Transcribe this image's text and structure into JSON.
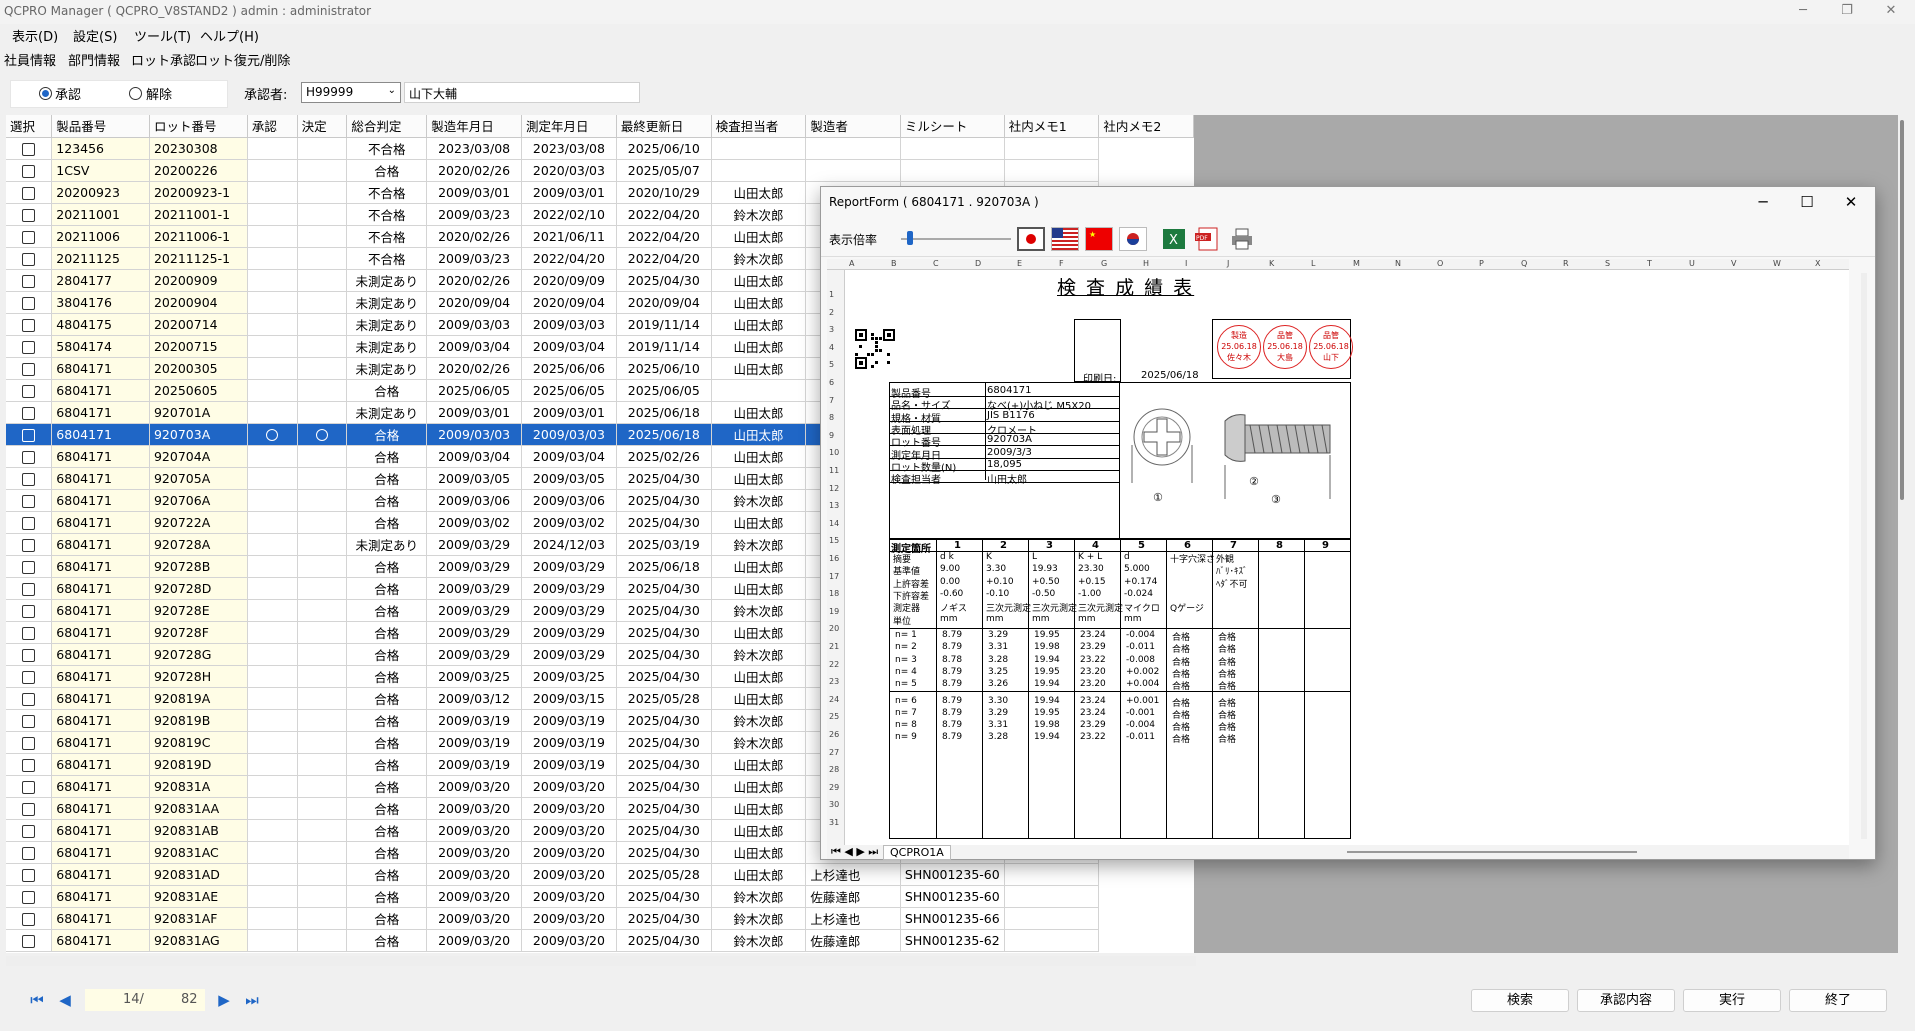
{
  "window": {
    "title": "QCPRO Manager ( QCPRO_V8STAND2 )    admin : administrator"
  },
  "menu": [
    "表示(D)",
    "設定(S)",
    "ツール(T)",
    "ヘルプ(H)"
  ],
  "subtabs": [
    "社員情報",
    "部門情報",
    "ロット承認",
    "ロット復元/削除"
  ],
  "mode": {
    "approve": "承認",
    "release": "解除",
    "selected": "承認"
  },
  "approver": {
    "label": "承認者:",
    "code": "H99999",
    "name": "山下大輔"
  },
  "columns": [
    "選択",
    "製品番号",
    "ロット番号",
    "承認",
    "決定",
    "総合判定",
    "製造年月日",
    "測定年月日",
    "最終更新日",
    "検査担当者",
    "製造者",
    "ミルシート",
    "社内メモ1",
    "社内メモ2"
  ],
  "rows": [
    [
      "123456",
      "20230308",
      "",
      "",
      "不合格",
      "2023/03/08",
      "2023/03/08",
      "2025/06/10",
      "",
      "",
      "",
      ""
    ],
    [
      "1CSV",
      "20200226",
      "",
      "",
      "合格",
      "2020/02/26",
      "2020/03/03",
      "2025/05/07",
      "",
      "",
      "",
      ""
    ],
    [
      "20200923",
      "20200923-1",
      "",
      "",
      "不合格",
      "2009/03/01",
      "2009/03/01",
      "2020/10/29",
      "山田太郎",
      "",
      "",
      ""
    ],
    [
      "20211001",
      "20211001-1",
      "",
      "",
      "不合格",
      "2009/03/23",
      "2022/02/10",
      "2022/04/20",
      "鈴木次郎",
      "",
      "",
      ""
    ],
    [
      "20211006",
      "20211006-1",
      "",
      "",
      "不合格",
      "2020/02/26",
      "2021/06/11",
      "2022/04/20",
      "山田太郎",
      "",
      "",
      ""
    ],
    [
      "20211125",
      "20211125-1",
      "",
      "",
      "不合格",
      "2009/03/23",
      "2022/04/20",
      "2022/04/20",
      "鈴木次郎",
      "",
      "",
      ""
    ],
    [
      "2804177",
      "20200909",
      "",
      "",
      "未測定あり",
      "2020/02/26",
      "2020/09/09",
      "2025/04/30",
      "山田太郎",
      "",
      "",
      ""
    ],
    [
      "3804176",
      "20200904",
      "",
      "",
      "未測定あり",
      "2020/09/04",
      "2020/09/04",
      "2020/09/04",
      "山田太郎",
      "",
      "",
      ""
    ],
    [
      "4804175",
      "20200714",
      "",
      "",
      "未測定あり",
      "2009/03/03",
      "2009/03/03",
      "2019/11/14",
      "山田太郎",
      "",
      "",
      ""
    ],
    [
      "5804174",
      "20200715",
      "",
      "",
      "未測定あり",
      "2009/03/04",
      "2009/03/04",
      "2019/11/14",
      "山田太郎",
      "",
      "",
      ""
    ],
    [
      "6804171",
      "20200305",
      "",
      "",
      "未測定あり",
      "2020/02/26",
      "2025/06/06",
      "2025/06/10",
      "山田太郎",
      "",
      "",
      ""
    ],
    [
      "6804171",
      "20250605",
      "",
      "",
      "合格",
      "2025/06/05",
      "2025/06/05",
      "2025/06/05",
      "",
      "",
      "",
      ""
    ],
    [
      "6804171",
      "920701A",
      "",
      "",
      "未測定あり",
      "2009/03/01",
      "2009/03/01",
      "2025/06/18",
      "山田太郎",
      "",
      "",
      ""
    ],
    [
      "6804171",
      "920703A",
      "○",
      "○",
      "合格",
      "2009/03/03",
      "2009/03/03",
      "2025/06/18",
      "山田太郎",
      "",
      "",
      ""
    ],
    [
      "6804171",
      "920704A",
      "",
      "",
      "合格",
      "2009/03/04",
      "2009/03/04",
      "2025/02/26",
      "山田太郎",
      "",
      "",
      ""
    ],
    [
      "6804171",
      "920705A",
      "",
      "",
      "合格",
      "2009/03/05",
      "2009/03/05",
      "2025/04/30",
      "山田太郎",
      "",
      "",
      ""
    ],
    [
      "6804171",
      "920706A",
      "",
      "",
      "合格",
      "2009/03/06",
      "2009/03/06",
      "2025/04/30",
      "鈴木次郎",
      "",
      "",
      ""
    ],
    [
      "6804171",
      "920722A",
      "",
      "",
      "合格",
      "2009/03/02",
      "2009/03/02",
      "2025/04/30",
      "山田太郎",
      "",
      "",
      ""
    ],
    [
      "6804171",
      "920728A",
      "",
      "",
      "未測定あり",
      "2009/03/29",
      "2024/12/03",
      "2025/03/19",
      "鈴木次郎",
      "",
      "",
      ""
    ],
    [
      "6804171",
      "920728B",
      "",
      "",
      "合格",
      "2009/03/29",
      "2009/03/29",
      "2025/06/18",
      "山田太郎",
      "",
      "",
      ""
    ],
    [
      "6804171",
      "920728D",
      "",
      "",
      "合格",
      "2009/03/29",
      "2009/03/29",
      "2025/04/30",
      "山田太郎",
      "",
      "",
      ""
    ],
    [
      "6804171",
      "920728E",
      "",
      "",
      "合格",
      "2009/03/29",
      "2009/03/29",
      "2025/04/30",
      "鈴木次郎",
      "",
      "",
      ""
    ],
    [
      "6804171",
      "920728F",
      "",
      "",
      "合格",
      "2009/03/29",
      "2009/03/29",
      "2025/04/30",
      "山田太郎",
      "",
      "",
      ""
    ],
    [
      "6804171",
      "920728G",
      "",
      "",
      "合格",
      "2009/03/29",
      "2009/03/29",
      "2025/04/30",
      "鈴木次郎",
      "",
      "",
      ""
    ],
    [
      "6804171",
      "920728H",
      "",
      "",
      "合格",
      "2009/03/25",
      "2009/03/25",
      "2025/04/30",
      "山田太郎",
      "",
      "",
      ""
    ],
    [
      "6804171",
      "920819A",
      "",
      "",
      "合格",
      "2009/03/12",
      "2009/03/15",
      "2025/05/28",
      "山田太郎",
      "",
      "",
      ""
    ],
    [
      "6804171",
      "920819B",
      "",
      "",
      "合格",
      "2009/03/19",
      "2009/03/19",
      "2025/04/30",
      "鈴木次郎",
      "",
      "",
      ""
    ],
    [
      "6804171",
      "920819C",
      "",
      "",
      "合格",
      "2009/03/19",
      "2009/03/19",
      "2025/04/30",
      "鈴木次郎",
      "",
      "",
      ""
    ],
    [
      "6804171",
      "920819D",
      "",
      "",
      "合格",
      "2009/03/19",
      "2009/03/19",
      "2025/04/30",
      "山田太郎",
      "",
      "",
      ""
    ],
    [
      "6804171",
      "920831A",
      "",
      "",
      "合格",
      "2009/03/20",
      "2009/03/20",
      "2025/04/30",
      "山田太郎",
      "",
      "",
      ""
    ],
    [
      "6804171",
      "920831AA",
      "",
      "",
      "合格",
      "2009/03/20",
      "2009/03/20",
      "2025/04/30",
      "山田太郎",
      "",
      "",
      ""
    ],
    [
      "6804171",
      "920831AB",
      "",
      "",
      "合格",
      "2009/03/20",
      "2009/03/20",
      "2025/04/30",
      "山田太郎",
      "",
      "",
      ""
    ],
    [
      "6804171",
      "920831AC",
      "",
      "",
      "合格",
      "2009/03/20",
      "2009/03/20",
      "2025/04/30",
      "山田太郎",
      "",
      "",
      ""
    ],
    [
      "6804171",
      "920831AD",
      "",
      "",
      "合格",
      "2009/03/20",
      "2009/03/20",
      "2025/05/28",
      "山田太郎",
      "上杉達也",
      "SHN001235-60",
      ""
    ],
    [
      "6804171",
      "920831AE",
      "",
      "",
      "合格",
      "2009/03/20",
      "2009/03/20",
      "2025/04/30",
      "鈴木次郎",
      "佐藤達郎",
      "SHN001235-60",
      ""
    ],
    [
      "6804171",
      "920831AF",
      "",
      "",
      "合格",
      "2009/03/20",
      "2009/03/20",
      "2025/04/30",
      "鈴木次郎",
      "上杉達也",
      "SHN001235-66",
      ""
    ],
    [
      "6804171",
      "920831AG",
      "",
      "",
      "合格",
      "2009/03/20",
      "2009/03/20",
      "2025/04/30",
      "鈴木次郎",
      "佐藤達郎",
      "SHN001235-62",
      ""
    ]
  ],
  "selected_row": 13,
  "footer": {
    "page": "14/",
    "total": "82",
    "buttons": [
      "検索",
      "承認内容",
      "実行",
      "終了"
    ]
  },
  "report": {
    "title": "ReportForm ( 6804171 . 920703A )",
    "zoom_label": "表示倍率",
    "doc_title": "検 査 成 績 表",
    "print_label": "印刷日:",
    "print_date": "2025/06/18",
    "stamps": [
      {
        "l1": "製造",
        "l2": "25.06.18",
        "l3": "佐々木"
      },
      {
        "l1": "品管",
        "l2": "25.06.18",
        "l3": "大島"
      },
      {
        "l1": "品管",
        "l2": "25.06.18",
        "l3": "山下"
      }
    ],
    "info": [
      [
        "製品番号",
        "6804171"
      ],
      [
        "品名・サイズ",
        "なべ(+)小ねじ M5X20"
      ],
      [
        "規格・材質",
        "JIS B1176"
      ],
      [
        "表面処理",
        "クロメート"
      ],
      [
        "ロット番号",
        "920703A"
      ],
      [
        "測定年月日",
        "2009/3/3"
      ],
      [
        "ロット数量(N)",
        "18,095"
      ],
      [
        "検査担当者",
        "山田太郎"
      ]
    ],
    "meas_headers": [
      "測定箇所",
      "1",
      "2",
      "3",
      "4",
      "5",
      "6",
      "7",
      "8",
      "9"
    ],
    "meas_rows": [
      [
        "摘要",
        "d k",
        "K",
        "L",
        "K + L",
        "d",
        "十字穴深さ",
        "外観"
      ],
      [
        "基準値",
        "9.00",
        "3.30",
        "19.93",
        "23.30",
        "5.000",
        "",
        "ﾊﾞﾘ･ｷｽﾞ"
      ],
      [
        "上許容差",
        "0.00",
        "+0.10",
        "+0.50",
        "+0.15",
        "+0.174",
        "",
        "ﾍﾀﾞ不可"
      ],
      [
        "下許容差",
        "-0.60",
        "-0.10",
        "-0.50",
        "-1.00",
        "-0.024",
        "",
        ""
      ],
      [
        "測定器",
        "ノギス",
        "三次元測定",
        "三次元測定",
        "三次元測定",
        "マイクロ",
        "Qゲージ",
        ""
      ],
      [
        "単位",
        "mm",
        "mm",
        "mm",
        "mm",
        "mm",
        "",
        ""
      ]
    ],
    "samples": [
      [
        "n= 1",
        "8.79",
        "3.29",
        "19.95",
        "23.24",
        "-0.004",
        "合格",
        "合格"
      ],
      [
        "n= 2",
        "8.79",
        "3.31",
        "19.98",
        "23.29",
        "-0.011",
        "合格",
        "合格"
      ],
      [
        "n= 3",
        "8.78",
        "3.28",
        "19.94",
        "23.22",
        "-0.008",
        "合格",
        "合格"
      ],
      [
        "n= 4",
        "8.79",
        "3.25",
        "19.95",
        "23.20",
        "+0.002",
        "合格",
        "合格"
      ],
      [
        "n= 5",
        "8.79",
        "3.26",
        "19.94",
        "23.20",
        "+0.004",
        "合格",
        "合格"
      ],
      [
        "n= 6",
        "8.79",
        "3.30",
        "19.94",
        "23.24",
        "+0.001",
        "合格",
        "合格"
      ],
      [
        "n= 7",
        "8.79",
        "3.29",
        "19.95",
        "23.24",
        "-0.001",
        "合格",
        "合格"
      ],
      [
        "n= 8",
        "8.79",
        "3.31",
        "19.98",
        "23.29",
        "-0.004",
        "合格",
        "合格"
      ],
      [
        "n= 9",
        "8.79",
        "3.28",
        "19.94",
        "23.22",
        "-0.011",
        "合格",
        "合格"
      ]
    ],
    "sheet_tab": "QCPRO1A",
    "col_letters": [
      "A",
      "B",
      "C",
      "D",
      "E",
      "F",
      "G",
      "H",
      "I",
      "J",
      "K",
      "L",
      "M",
      "N",
      "O",
      "P",
      "Q",
      "R",
      "S",
      "T",
      "U",
      "V",
      "W",
      "X"
    ],
    "draw_labels": [
      "①",
      "②",
      "③"
    ]
  }
}
